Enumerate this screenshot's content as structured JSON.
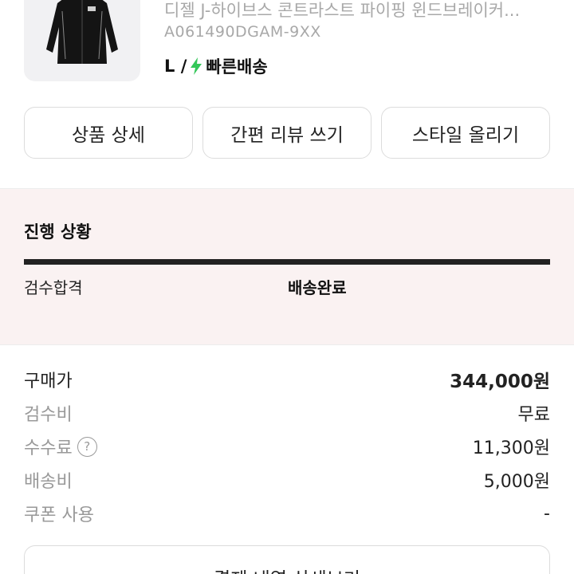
{
  "product": {
    "name": "디젤 J-하이브스 콘트라스트 파이핑 윈드브레이커...",
    "code": "A061490DGAM-9XX",
    "size": "L /",
    "shipping_label": "빠른배송",
    "shipping_icon": "lightning-bolt-icon",
    "shipping_color": "#34c759"
  },
  "actions": {
    "detail_label": "상품 상세",
    "review_label": "간편 리뷰 쓰기",
    "style_label": "스타일 올리기"
  },
  "progress": {
    "title": "진행 상황",
    "steps": [
      {
        "label": "검수합격"
      },
      {
        "label": "배송완료"
      }
    ],
    "completed": 1.0
  },
  "prices": {
    "purchase_label": "구매가",
    "purchase_value": "344,000원",
    "inspection_label": "검수비",
    "inspection_value": "무료",
    "fee_label": "수수료",
    "fee_help_icon": "question-circle-icon",
    "fee_value": "11,300원",
    "shipping_label": "배송비",
    "shipping_value": "5,000원",
    "coupon_label": "쿠폰 사용",
    "coupon_value": "-"
  },
  "footer": {
    "detail_button": "결제 내역 상세보기"
  }
}
